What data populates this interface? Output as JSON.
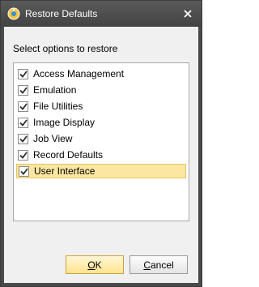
{
  "window": {
    "title": "Restore Defaults",
    "app_icon": "restore-app-icon",
    "close_icon": "close-icon"
  },
  "instruction": "Select options to restore",
  "options": [
    {
      "label": "Access Management",
      "checked": true,
      "selected": false
    },
    {
      "label": "Emulation",
      "checked": true,
      "selected": false
    },
    {
      "label": "File Utilities",
      "checked": true,
      "selected": false
    },
    {
      "label": "Image Display",
      "checked": true,
      "selected": false
    },
    {
      "label": "Job View",
      "checked": true,
      "selected": false
    },
    {
      "label": "Record Defaults",
      "checked": true,
      "selected": false
    },
    {
      "label": "User Interface",
      "checked": true,
      "selected": true
    }
  ],
  "buttons": {
    "ok": {
      "mnemonic": "O",
      "rest": "K"
    },
    "cancel": {
      "mnemonic": "C",
      "rest": "ancel"
    }
  },
  "colors": {
    "selection": "#fbe7a1",
    "selection_border": "#e7c45d",
    "titlebar": "#4a4a4a"
  }
}
